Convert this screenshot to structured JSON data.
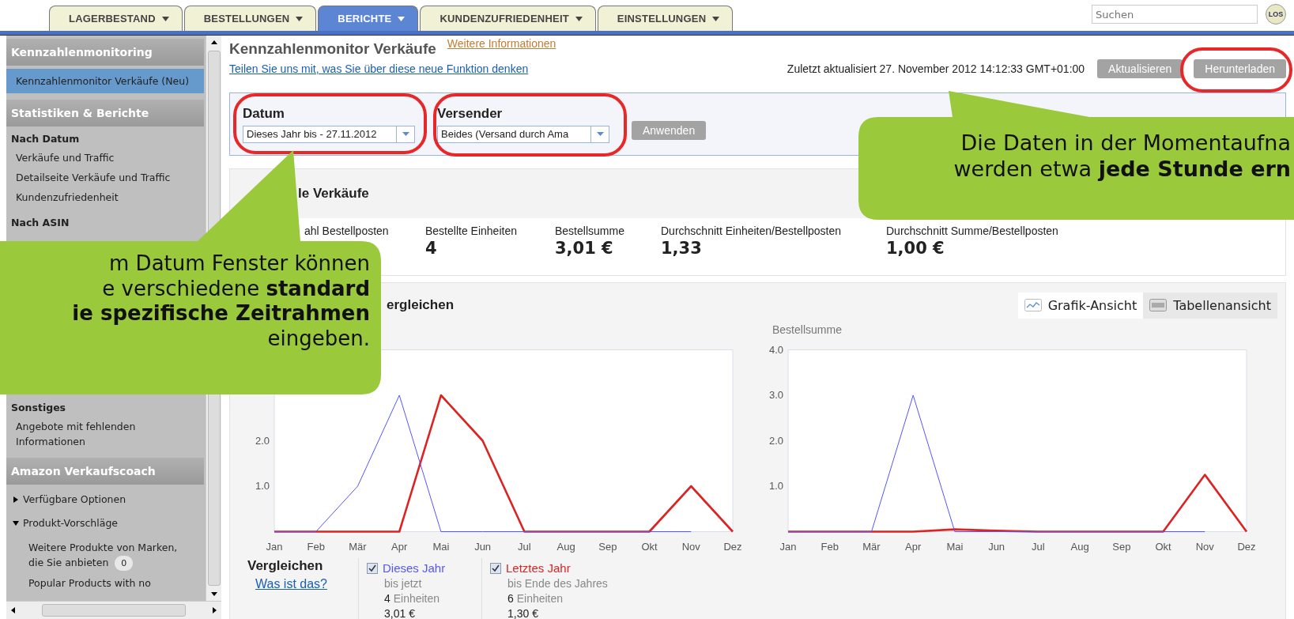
{
  "tabs": [
    {
      "label": "LAGERBESTAND",
      "selected": false
    },
    {
      "label": "BESTELLUNGEN",
      "selected": false
    },
    {
      "label": "BERICHTE",
      "selected": true
    },
    {
      "label": "KUNDENZUFRIEDENHEIT",
      "selected": false
    },
    {
      "label": "EINSTELLUNGEN",
      "selected": false
    }
  ],
  "search": {
    "placeholder": "Suchen",
    "button": "LOS"
  },
  "sidebar": {
    "sections": [
      {
        "title": "Kennzahlenmonitoring",
        "groups": [
          {
            "items": [
              {
                "label": "Kennzahlenmonitor Verkäufe (Neu)",
                "selected": true
              }
            ]
          }
        ]
      },
      {
        "title": "Statistiken & Berichte",
        "groups": [
          {
            "heading": "Nach Datum",
            "items": [
              {
                "label": "Verkäufe und Traffic",
                "selected": false
              },
              {
                "label": "Detailseite Verkäufe und Traffic",
                "selected": false
              },
              {
                "label": "Kundenzufriedenheit",
                "selected": false
              }
            ]
          },
          {
            "heading": "Nach ASIN"
          },
          {
            "heading": "Sonstiges",
            "items": [
              {
                "label": "Angebote mit fehlenden Informationen",
                "selected": false
              }
            ]
          }
        ]
      },
      {
        "title": "Amazon Verkaufscoach",
        "groups": [
          {
            "expanders": [
              {
                "label": "Verfügbare Optionen",
                "expanded": false
              },
              {
                "label": "Produkt-Vorschläge",
                "expanded": true,
                "children": [
                  {
                    "label": "Weitere Produkte von Marken, die Sie anbieten",
                    "badge": "0"
                  },
                  {
                    "label": "Popular Products with no"
                  }
                ]
              }
            ]
          }
        ]
      }
    ]
  },
  "page": {
    "title": "Kennzahlenmonitor Verkäufe",
    "info_link": "Weitere Informationen",
    "feedback_link": "Teilen Sie uns mit, was Sie über diese neue Funktion denken",
    "updated": "Zuletzt aktualisiert 27. November 2012 14:12:33 GMT+01:00",
    "buttons": [
      "Aktualisieren",
      "Herunterladen"
    ]
  },
  "filters": {
    "fields": [
      {
        "label": "Datum",
        "value": "Dieses Jahr bis - 27.11.2012"
      },
      {
        "label": "Versender",
        "value": "Beides (Versand durch Ama"
      }
    ],
    "apply": "Anwenden"
  },
  "summary": {
    "title": "le Verkäufe",
    "metrics": [
      {
        "label": "ahl Bestellposten"
      },
      {
        "label": "Bestellte Einheiten",
        "value": "4"
      },
      {
        "label": "Bestellsumme",
        "value": "3,01 €"
      },
      {
        "label": "Durchschnitt Einheiten/Bestellposten",
        "value": "1,33"
      },
      {
        "label": "Durchschnitt Summe/Bestellposten",
        "value": "1,00 €"
      }
    ]
  },
  "compare": {
    "title": "ergleichen",
    "views": [
      {
        "kind": "graph",
        "label": "Grafik-Ansicht",
        "selected": true
      },
      {
        "kind": "table",
        "label": "Tabellenansicht",
        "selected": false
      }
    ],
    "charts": [
      {
        "chart_data": {
          "type": "line",
          "categories": [
            "Jan",
            "Feb",
            "Mär",
            "Apr",
            "Mai",
            "Jun",
            "Jul",
            "Aug",
            "Sep",
            "Okt",
            "Nov",
            "Dez"
          ],
          "ylim": [
            0,
            4
          ],
          "yticks": [
            {
              "value": 1,
              "label": "1.0"
            },
            {
              "value": 2,
              "label": "2.0"
            }
          ],
          "series": [
            {
              "color": "#5555ff",
              "values": [
                0,
                0,
                1,
                3,
                0,
                0,
                0,
                0,
                0,
                0,
                0,
                null
              ]
            },
            {
              "color": "#dd2222",
              "values": [
                0,
                0,
                0,
                0,
                3,
                2,
                0,
                0,
                0,
                0,
                1,
                0
              ]
            }
          ]
        }
      },
      {
        "chart_data": {
          "type": "line",
          "ylabel": "Bestellsumme",
          "categories": [
            "Jan",
            "Feb",
            "Mär",
            "Apr",
            "Mai",
            "Jun",
            "Jul",
            "Aug",
            "Sep",
            "Okt",
            "Nov",
            "Dez"
          ],
          "ylim": [
            0,
            4
          ],
          "yticks": [
            {
              "value": 1,
              "label": "1.0"
            },
            {
              "value": 2,
              "label": "2.0"
            },
            {
              "value": 3,
              "label": "3.0"
            },
            {
              "value": 4,
              "label": "4.0"
            }
          ],
          "series": [
            {
              "color": "#5555ff",
              "values": [
                0,
                0,
                0,
                3,
                0,
                0,
                0,
                0,
                0,
                0,
                0,
                null
              ]
            },
            {
              "color": "#dd2222",
              "values": [
                0,
                0,
                0,
                0,
                0.05,
                0.02,
                0,
                0,
                0,
                0,
                1.25,
                0
              ]
            }
          ]
        }
      }
    ],
    "legend": {
      "title": "Vergleichen",
      "link": "Was ist das?",
      "series": [
        {
          "name": "Dieses Jahr",
          "color": "#5555ff",
          "checked": true,
          "note": "bis jetzt",
          "units": "4",
          "units_label": "Einheiten",
          "sum": "3,01 €"
        },
        {
          "name": "Letztes Jahr",
          "color": "#dd2222",
          "checked": true,
          "note": "bis Ende des Jahres",
          "units": "6",
          "units_label": "Einheiten",
          "sum": "1,30 €"
        }
      ]
    }
  },
  "callouts": [
    {
      "kind": "left",
      "text": "m Datum Fenster können\ne verschiedene **standard**\n**ie spezifische Zeitrahmen**\neingeben."
    },
    {
      "kind": "right",
      "text": "Die Daten in der Momentaufna\nwerden etwa **jede Stunde ern**"
    }
  ]
}
